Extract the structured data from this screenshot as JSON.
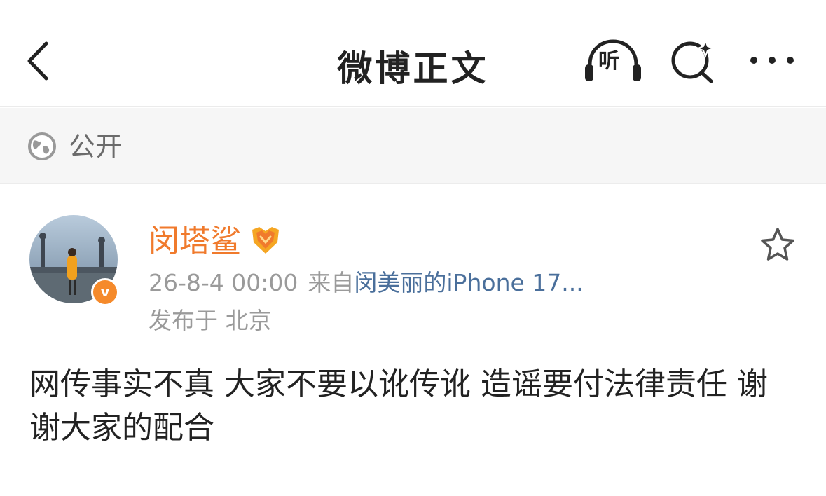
{
  "header": {
    "title": "微博正文",
    "listen_label": "听"
  },
  "visibility": {
    "label": "公开"
  },
  "post": {
    "author": "闵塔鲨",
    "time": "26-8-4 00:00",
    "source_prefix": "来自",
    "source_device": "闵美丽的iPhone 17...",
    "location": "发布于 北京",
    "verified_badge": "v",
    "text": "网传事实不真 大家不要以讹传讹 造谣要付法律责任 谢谢大家的配合"
  },
  "colors": {
    "accent_orange": "#f07a2c",
    "link_blue": "#4a6f9b"
  }
}
